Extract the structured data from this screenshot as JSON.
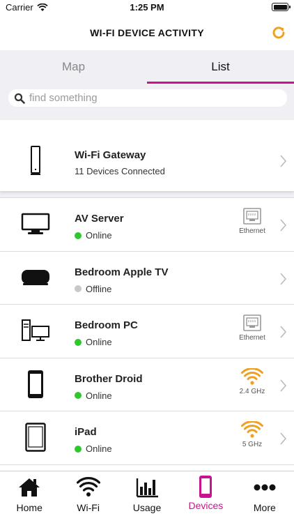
{
  "status_bar": {
    "carrier": "Carrier",
    "time": "1:25 PM"
  },
  "header": {
    "title": "WI-FI DEVICE ACTIVITY"
  },
  "tabs": [
    {
      "label": "Map",
      "active": false
    },
    {
      "label": "List",
      "active": true
    }
  ],
  "search": {
    "placeholder": "find something",
    "value": ""
  },
  "gateway": {
    "name": "Wi-Fi Gateway",
    "subtitle": "11 Devices Connected",
    "icon": "gateway-icon"
  },
  "devices": [
    {
      "name": "AV Server",
      "status": "Online",
      "status_color": "#2ec82e",
      "connection": "Ethernet",
      "icon": "monitor-icon"
    },
    {
      "name": "Bedroom Apple TV",
      "status": "Offline",
      "status_color": "#c8c8c8",
      "connection": "",
      "icon": "apple-tv-icon"
    },
    {
      "name": "Bedroom PC",
      "status": "Online",
      "status_color": "#2ec82e",
      "connection": "Ethernet",
      "icon": "desktop-pc-icon"
    },
    {
      "name": "Brother Droid",
      "status": "Online",
      "status_color": "#2ec82e",
      "connection": "2.4 GHz",
      "icon": "phone-icon"
    },
    {
      "name": "iPad",
      "status": "Online",
      "status_color": "#2ec82e",
      "connection": "5 GHz",
      "icon": "tablet-icon"
    }
  ],
  "tabbar": [
    {
      "label": "Home",
      "icon": "home-icon",
      "active": false
    },
    {
      "label": "Wi-Fi",
      "icon": "wifi-icon",
      "active": false
    },
    {
      "label": "Usage",
      "icon": "usage-chart-icon",
      "active": false
    },
    {
      "label": "Devices",
      "icon": "devices-icon",
      "active": true
    },
    {
      "label": "More",
      "icon": "more-icon",
      "active": false
    }
  ],
  "colors": {
    "accent": "#c8148c",
    "refresh": "#f0a020",
    "wifi": "#f0a020",
    "online": "#2ec82e",
    "offline": "#c8c8c8"
  }
}
